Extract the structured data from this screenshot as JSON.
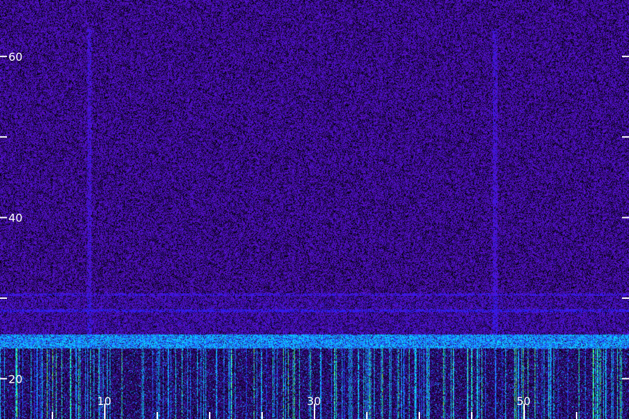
{
  "chart_data": {
    "type": "heatmap",
    "title": "",
    "xlabel": "",
    "ylabel": "",
    "x_ticks": {
      "labeled": [
        {
          "value": 10,
          "label": "10"
        },
        {
          "value": 30,
          "label": "30"
        },
        {
          "value": 50,
          "label": "50"
        }
      ],
      "minor": [
        5,
        10,
        15,
        20,
        25,
        30,
        35,
        40,
        45,
        50,
        55
      ]
    },
    "y_ticks": {
      "labeled": [
        {
          "value": 20,
          "label": "20"
        },
        {
          "value": 40,
          "label": "40"
        },
        {
          "value": 60,
          "label": "60"
        }
      ],
      "unlabeled": [
        30,
        50
      ]
    },
    "xlim": [
      0,
      60
    ],
    "ylim": [
      15,
      67
    ],
    "colormap": [
      "#000000",
      "#2a0a6e",
      "#5a10c8",
      "#2020ff",
      "#1e90ff",
      "#00e0ff",
      "#40ff80",
      "#c8ff00"
    ],
    "features": {
      "dense_band_upper_edge_y": 25,
      "horizontal_lines_y": [
        28.5,
        30.5
      ],
      "vertical_streaks_x": [
        8.5,
        47.2
      ]
    }
  }
}
